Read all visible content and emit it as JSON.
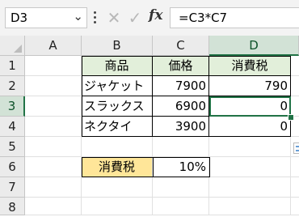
{
  "formula_bar": {
    "name_box": "D3",
    "name_dropdown": "⌄",
    "cancel_glyph": "✕",
    "enter_glyph": "✓",
    "fx_label": "fx",
    "formula": "=C3*C7"
  },
  "columns": [
    "A",
    "B",
    "C",
    "D"
  ],
  "rows": [
    "1",
    "2",
    "3",
    "4",
    "5",
    "6",
    "7",
    "8"
  ],
  "selected_cell": {
    "column": "D",
    "row": "3"
  },
  "cells": {
    "B1": "商品",
    "C1": "価格",
    "D1": "消費税",
    "B2": "ジャケット",
    "C2": "7900",
    "D2": "790",
    "B3": "スラックス",
    "C3": "6900",
    "D3": "0",
    "B4": "ネクタイ",
    "C4": "3900",
    "D4": "0",
    "B6": "消費税",
    "C6": "10%"
  },
  "colors": {
    "header_fill": "#e2efda",
    "tax_label_fill": "#ffe699",
    "selection": "#217346"
  }
}
